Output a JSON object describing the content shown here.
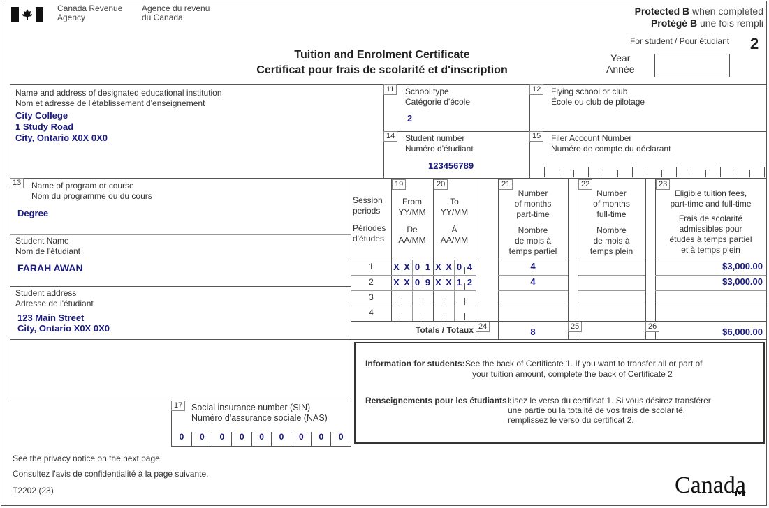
{
  "header": {
    "agency_en": [
      "Canada Revenue",
      "Agency"
    ],
    "agency_fr": [
      "Agence du revenu",
      "du Canada"
    ],
    "protected_en_bold": "Protected B",
    "protected_en_rest": " when completed",
    "protected_fr_bold": "Protégé B",
    "protected_fr_rest": " une fois rempli",
    "copy_for": "For student / Pour étudiant",
    "copy_number": "2",
    "title_en": "Tuition and Enrolment Certificate",
    "title_fr": "Certificat pour frais de scolarité et d'inscription",
    "year_label": [
      "Year",
      "Année"
    ],
    "year_value": ""
  },
  "institution": {
    "label_en": "Name and address of designated educational institution",
    "label_fr": "Nom et adresse de l'établissement d'enseignement",
    "lines": [
      "City College",
      "1 Study Road",
      "City, Ontario X0X 0X0"
    ]
  },
  "box11": {
    "num": "11",
    "label_en": "School type",
    "label_fr": "Catégorie d'école",
    "value": "2"
  },
  "box12": {
    "num": "12",
    "label_en": "Flying school or club",
    "label_fr": "École ou club de pilotage",
    "value": ""
  },
  "box14": {
    "num": "14",
    "label_en": "Student number",
    "label_fr": "Numéro d'étudiant",
    "value": "123456789"
  },
  "box15": {
    "num": "15",
    "label_en": "Filer Account Number",
    "label_fr": "Numéro de compte du déclarant",
    "value": ""
  },
  "box13": {
    "num": "13",
    "label_en": "Name of program or course",
    "label_fr": "Nom du programme ou du cours",
    "value": "Degree"
  },
  "student_name": {
    "label_en": "Student Name",
    "label_fr": "Nom de l'étudiant",
    "value": "FARAH AWAN"
  },
  "student_address": {
    "label_en": "Student address",
    "label_fr": "Adresse de l'étudiant",
    "lines": [
      "123 Main Street",
      "City, Ontario X0X 0X0"
    ]
  },
  "box17": {
    "num": "17",
    "label_en": "Social insurance number (SIN)",
    "label_fr": "Numéro d'assurance sociale (NAS)",
    "digits": [
      "0",
      "0",
      "0",
      "0",
      "0",
      "0",
      "0",
      "0",
      "0"
    ]
  },
  "sessions": {
    "header_session": [
      "Session",
      "periods",
      "Périodes",
      "d'études"
    ],
    "box19": {
      "num": "19",
      "lines_en": [
        "From",
        "YY/MM"
      ],
      "lines_fr": [
        "De",
        "AA/MM"
      ]
    },
    "box20": {
      "num": "20",
      "lines_en": [
        "To",
        "YY/MM"
      ],
      "lines_fr": [
        "À",
        "AA/MM"
      ]
    },
    "box21": {
      "num": "21",
      "lines_en": [
        "Number",
        "of months",
        "part-time"
      ],
      "lines_fr": [
        "Nombre",
        "de mois à",
        "temps partiel"
      ]
    },
    "box22": {
      "num": "22",
      "lines_en": [
        "Number",
        "of months",
        "full-time"
      ],
      "lines_fr": [
        "Nombre",
        "de mois à",
        "temps plein"
      ]
    },
    "box23": {
      "num": "23",
      "lines_en": [
        "Eligible tuition fees,",
        "part-time and full-time"
      ],
      "lines_fr": [
        "Frais de scolarité",
        "admissibles pour",
        "études à temps partiel",
        "et à temps plein"
      ]
    },
    "rows": [
      {
        "period": "1",
        "from": [
          "X",
          "X",
          "0",
          "1"
        ],
        "to": [
          "X",
          "X",
          "0",
          "4"
        ],
        "part_time": "4",
        "full_time": "",
        "fees": "$3,000.00"
      },
      {
        "period": "2",
        "from": [
          "X",
          "X",
          "0",
          "9"
        ],
        "to": [
          "X",
          "X",
          "1",
          "2"
        ],
        "part_time": "4",
        "full_time": "",
        "fees": "$3,000.00"
      },
      {
        "period": "3",
        "from": [
          "",
          "",
          "",
          ""
        ],
        "to": [
          "",
          "",
          "",
          ""
        ],
        "part_time": "",
        "full_time": "",
        "fees": ""
      },
      {
        "period": "4",
        "from": [
          "",
          "",
          "",
          ""
        ],
        "to": [
          "",
          "",
          "",
          ""
        ],
        "part_time": "",
        "full_time": "",
        "fees": ""
      }
    ],
    "totals_label": "Totals / Totaux",
    "box24": {
      "num": "24",
      "value": "8"
    },
    "box25": {
      "num": "25",
      "value": ""
    },
    "box26": {
      "num": "26",
      "value": "$6,000.00"
    }
  },
  "info": {
    "en_label": "Information for students:",
    "en_lines": [
      "See the back of Certificate 1. If you want to transfer all or part of",
      "your tuition amount, complete the back of Certificate 2"
    ],
    "fr_label": "Renseignements pour les étudiants :",
    "fr_lines": [
      "Lisez le verso du certificat 1. Si vous désirez transférer",
      "une partie ou la totalité de vos frais de scolarité,",
      "remplissez le verso du certificat 2."
    ]
  },
  "footer": {
    "privacy_en": "See the privacy notice on the next page.",
    "privacy_fr": "Consultez l'avis de confidentialité à la page suivante.",
    "form_code": "T2202 (23)",
    "wordmark": "Canada"
  }
}
